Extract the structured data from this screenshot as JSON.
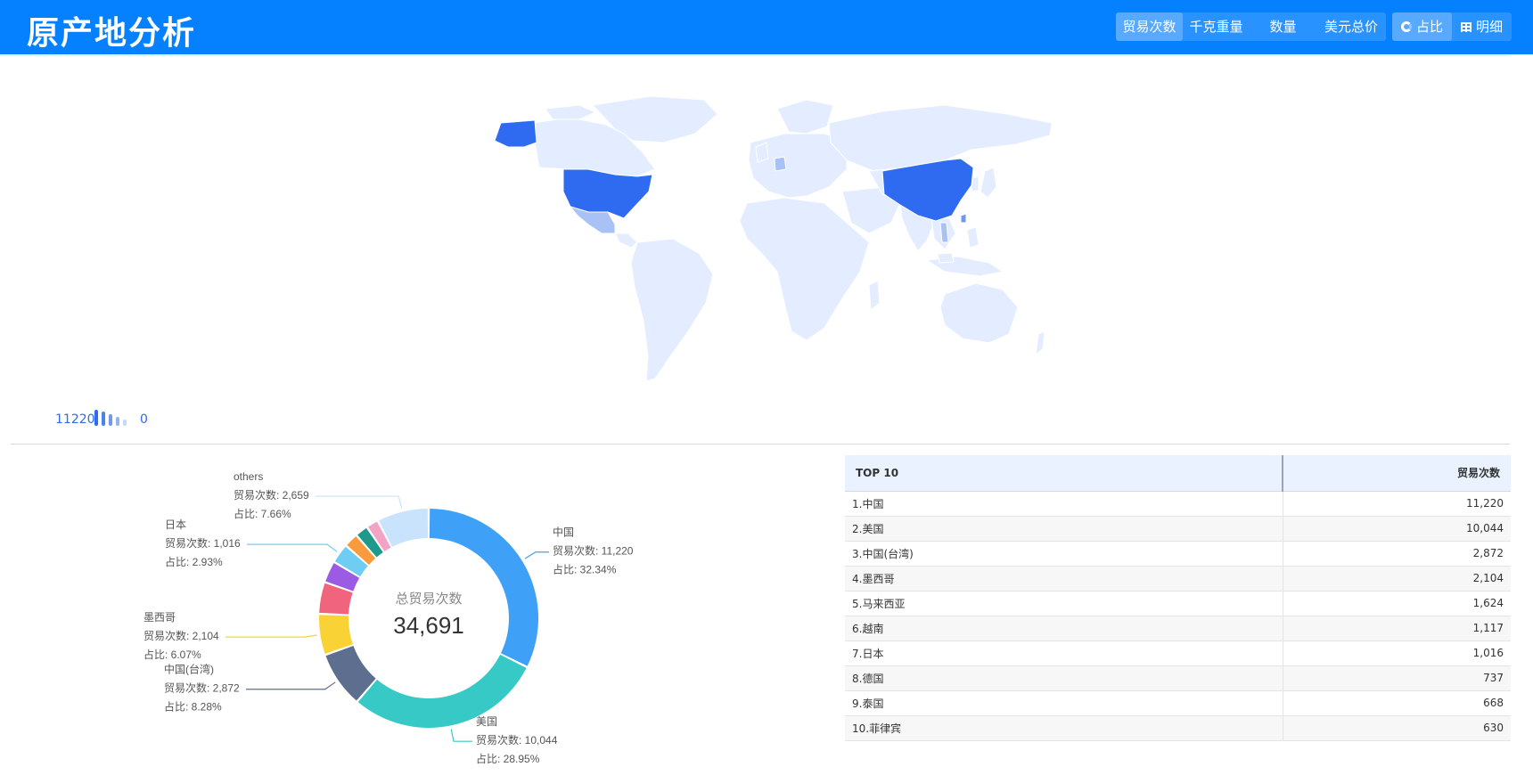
{
  "header": {
    "title": "原产地分析",
    "metrics": [
      "贸易次数",
      "千克重量",
      "数量",
      "美元总价"
    ],
    "active_metric": 0,
    "views": [
      {
        "label": "占比",
        "icon": "pie-chart-icon"
      },
      {
        "label": "明细",
        "icon": "table-icon"
      }
    ]
  },
  "map": {
    "legend_max": "11220",
    "legend_min": "0",
    "colors": {
      "high": "#2e6bf0",
      "mid": "#6f98ee",
      "low": "#a9c2f5",
      "base": "#e4edff"
    }
  },
  "chart_data": {
    "type": "pie",
    "center_label": "总贸易次数",
    "total": "34,691",
    "metric_label": "贸易次数",
    "share_label": "占比",
    "slices": [
      {
        "name": "中国",
        "value": 11220,
        "value_text": "11,220",
        "pct": "32.34%",
        "color": "#3ea0f7"
      },
      {
        "name": "美国",
        "value": 10044,
        "value_text": "10,044",
        "pct": "28.95%",
        "color": "#37c9c6"
      },
      {
        "name": "中国(台湾)",
        "value": 2872,
        "value_text": "2,872",
        "pct": "8.28%",
        "color": "#5d6e8f"
      },
      {
        "name": "墨西哥",
        "value": 2104,
        "value_text": "2,104",
        "pct": "6.07%",
        "color": "#f9d336"
      },
      {
        "name": "",
        "value": 1624,
        "color": "#f0657d"
      },
      {
        "name": "",
        "value": 1117,
        "color": "#9b5ce3"
      },
      {
        "name": "日本",
        "value": 1016,
        "value_text": "1,016",
        "pct": "2.93%",
        "color": "#6fcdf3"
      },
      {
        "name": "",
        "value": 737,
        "color": "#f99a3c"
      },
      {
        "name": "",
        "value": 668,
        "color": "#1f9a8a"
      },
      {
        "name": "",
        "value": 630,
        "color": "#f4a3c6"
      },
      {
        "name": "others",
        "value": 2659,
        "value_text": "2,659",
        "pct": "7.66%",
        "color": "#c8e3fb"
      }
    ]
  },
  "table": {
    "col_name": "TOP 10",
    "col_value": "贸易次数",
    "rows": [
      {
        "name": "1.中国",
        "value": "11,220"
      },
      {
        "name": "2.美国",
        "value": "10,044"
      },
      {
        "name": "3.中国(台湾)",
        "value": "2,872"
      },
      {
        "name": "4.墨西哥",
        "value": "2,104"
      },
      {
        "name": "5.马来西亚",
        "value": "1,624"
      },
      {
        "name": "6.越南",
        "value": "1,117"
      },
      {
        "name": "7.日本",
        "value": "1,016"
      },
      {
        "name": "8.德国",
        "value": "737"
      },
      {
        "name": "9.泰国",
        "value": "668"
      },
      {
        "name": "10.菲律宾",
        "value": "630"
      }
    ]
  }
}
